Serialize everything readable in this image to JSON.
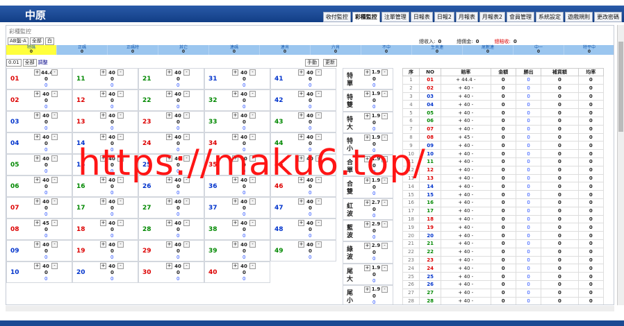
{
  "app": {
    "logo": "中原"
  },
  "nav": [
    "收付監控",
    "彩種監控",
    "注單管理",
    "日報表",
    "日報2",
    "月報表",
    "月報表2",
    "會員管理",
    "系統設定",
    "遊戲規則",
    "更改密碼"
  ],
  "page": {
    "title": "彩種監控",
    "filter1": "AB盤-A",
    "filter2": "全部",
    "filter3": "白",
    "totals": [
      {
        "label": "總收入:",
        "value": "0"
      },
      {
        "label": "總佣金:",
        "value": "0"
      },
      {
        "label": "總賠收:",
        "value": "0"
      }
    ]
  },
  "summary": [
    {
      "label": "特碼",
      "value": "0"
    },
    {
      "label": "正碼",
      "value": "0"
    },
    {
      "label": "正碼特",
      "value": "0"
    },
    {
      "label": "其它",
      "value": "0"
    },
    {
      "label": "連碼",
      "value": "0"
    },
    {
      "label": "連肖",
      "value": "0"
    },
    {
      "label": "六肖",
      "value": "0"
    },
    {
      "label": "不中",
      "value": "0"
    },
    {
      "label": "生肖連",
      "value": "0"
    },
    {
      "label": "尾數連",
      "value": "0"
    },
    {
      "label": "中一",
      "value": "0"
    },
    {
      "label": "特平中",
      "value": "0"
    }
  ],
  "controls": {
    "step": "0.01",
    "scope": "全部",
    "adjust": "調整",
    "mode": "手動",
    "refresh": "更新"
  },
  "numbers": [
    "01",
    "02",
    "03",
    "04",
    "05",
    "06",
    "07",
    "08",
    "09",
    "10",
    "11",
    "12",
    "13",
    "14",
    "15",
    "16",
    "17",
    "18",
    "19",
    "20",
    "21",
    "22",
    "23",
    "24",
    "25",
    "26",
    "27",
    "28",
    "29",
    "30",
    "31",
    "32",
    "33",
    "34",
    "35",
    "36",
    "37",
    "38",
    "39",
    "40",
    "41",
    "42",
    "43",
    "44",
    "45",
    "46",
    "47",
    "48",
    "49"
  ],
  "colors": {
    "red": "#d00",
    "green": "#080",
    "blue": "#0033cc"
  },
  "misc": [
    {
      "label": "特單",
      "rate": "1.9"
    },
    {
      "label": "特雙",
      "rate": "1.9"
    },
    {
      "label": "特大",
      "rate": "1.9"
    },
    {
      "label": "特小",
      "rate": "1.9"
    },
    {
      "label": "合單",
      "rate": "1.9"
    },
    {
      "label": "合雙",
      "rate": "1.9"
    },
    {
      "label": "紅波",
      "rate": "2.7"
    },
    {
      "label": "藍波",
      "rate": "2.9"
    },
    {
      "label": "綠波",
      "rate": "2.9"
    },
    {
      "label": "尾大",
      "rate": "1.9"
    },
    {
      "label": "尾小",
      "rate": "1.9"
    }
  ],
  "table": {
    "headers": [
      "序",
      "NO",
      "賠率",
      "金額",
      "勝出",
      "補貨額",
      "均率"
    ]
  },
  "watermark": "https://maku6.top/"
}
